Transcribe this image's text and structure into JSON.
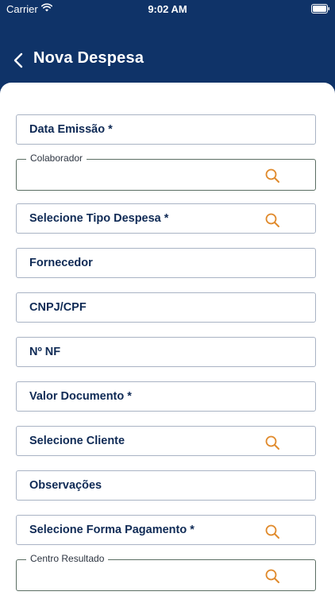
{
  "status_bar": {
    "carrier": "Carrier",
    "time": "9:02 AM"
  },
  "header": {
    "title": "Nova Despesa"
  },
  "form": {
    "data_emissao": "Data Emissão *",
    "colaborador": "Colaborador",
    "tipo_despesa": "Selecione Tipo Despesa *",
    "fornecedor": "Fornecedor",
    "cnpj_cpf": "CNPJ/CPF",
    "numero_nf": "Nº NF",
    "valor_documento": "Valor Documento *",
    "cliente": "Selecione Cliente",
    "observacoes": "Observações",
    "forma_pagamento": "Selecione Forma Pagamento *",
    "centro_resultado": "Centro Resultado"
  },
  "colors": {
    "header_bg": "#0f3368",
    "label_text": "#0f2a55",
    "search_icon": "#e08a2c",
    "border": "#a9b3c4"
  },
  "icons": [
    "wifi-icon",
    "battery-icon",
    "back-chevron-icon",
    "search-icon"
  ]
}
